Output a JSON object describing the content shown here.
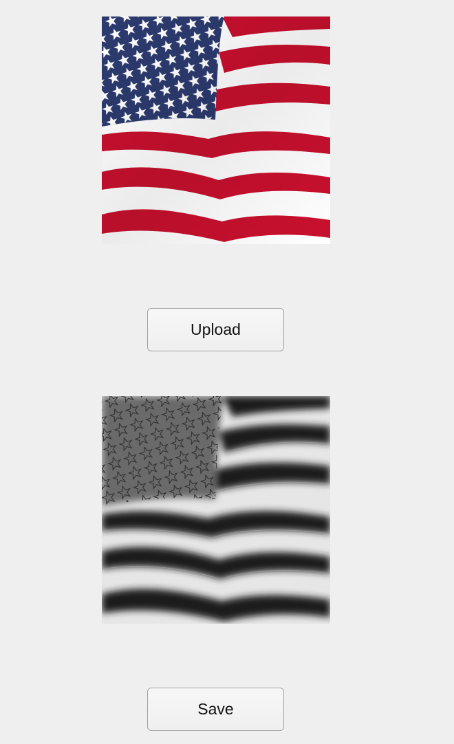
{
  "actions": {
    "upload_label": "Upload",
    "save_label": "Save"
  },
  "images": {
    "original": {
      "subject": "american-flag-waving",
      "style": "color"
    },
    "processed": {
      "subject": "american-flag-waving",
      "style": "grayscale-embossed"
    }
  },
  "colors": {
    "background": "#efefef",
    "flag_red": "#c8102e",
    "flag_white": "#ffffff",
    "flag_blue": "#2c3a6e"
  }
}
